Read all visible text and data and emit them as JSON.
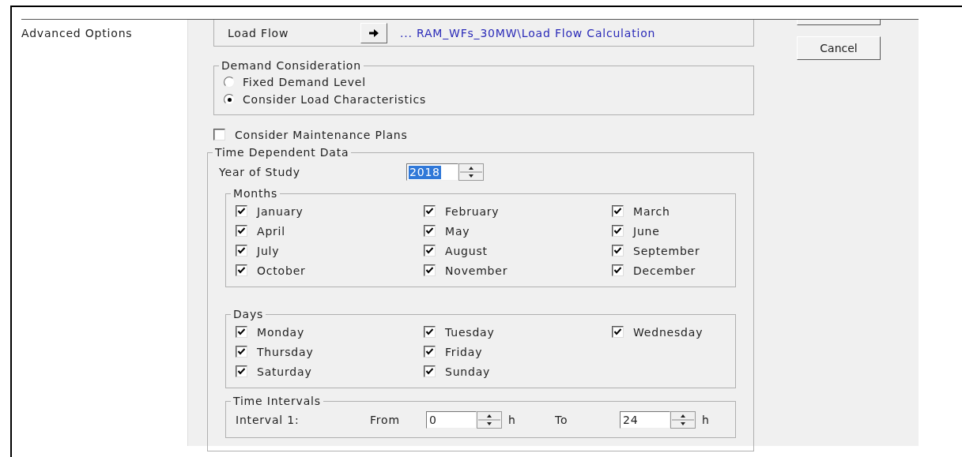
{
  "sidebar": {
    "label": "Advanced Options"
  },
  "load_flow": {
    "label": "Load Flow",
    "path": "... RAM_WFs_30MW\\Load Flow Calculation"
  },
  "demand": {
    "title": "Demand Consideration",
    "options": [
      {
        "label": "Fixed Demand Level",
        "selected": false
      },
      {
        "label": "Consider Load Characteristics",
        "selected": true
      }
    ]
  },
  "maintenance": {
    "label": "Consider Maintenance Plans",
    "checked": false
  },
  "time_data": {
    "title": "Time Dependent Data",
    "year": {
      "label": "Year of Study",
      "value": "2018",
      "value_selected": true
    },
    "months": {
      "title": "Months",
      "rows": [
        [
          {
            "label": "January",
            "checked": true
          },
          {
            "label": "February",
            "checked": true
          },
          {
            "label": "March",
            "checked": true
          }
        ],
        [
          {
            "label": "April",
            "checked": true
          },
          {
            "label": "May",
            "checked": true
          },
          {
            "label": "June",
            "checked": true
          }
        ],
        [
          {
            "label": "July",
            "checked": true
          },
          {
            "label": "August",
            "checked": true
          },
          {
            "label": "September",
            "checked": true
          }
        ],
        [
          {
            "label": "October",
            "checked": true
          },
          {
            "label": "November",
            "checked": true
          },
          {
            "label": "December",
            "checked": true
          }
        ]
      ]
    },
    "days": {
      "title": "Days",
      "rows": [
        [
          {
            "label": "Monday",
            "checked": true
          },
          {
            "label": "Tuesday",
            "checked": true
          },
          {
            "label": "Wednesday",
            "checked": true
          }
        ],
        [
          {
            "label": "Thursday",
            "checked": true
          },
          {
            "label": "Friday",
            "checked": true
          }
        ],
        [
          {
            "label": "Saturday",
            "checked": true
          },
          {
            "label": "Sunday",
            "checked": true
          }
        ]
      ]
    },
    "intervals": {
      "title": "Time Intervals",
      "rows": [
        {
          "label": "Interval 1:",
          "from_label": "From",
          "from": "0",
          "from_unit": "h",
          "to_label": "To",
          "to": "24",
          "to_unit": "h"
        }
      ]
    }
  },
  "buttons": [
    {
      "label": "Cancel"
    }
  ]
}
